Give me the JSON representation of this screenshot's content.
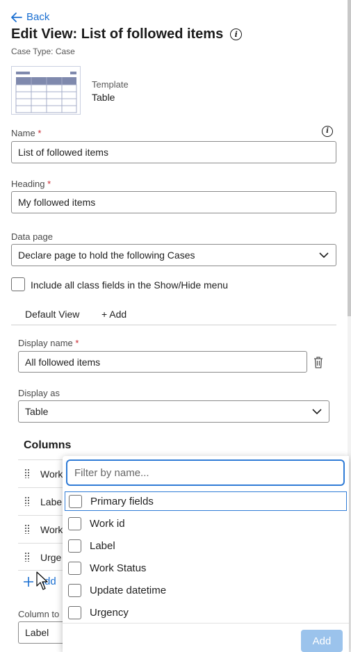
{
  "nav": {
    "back_label": "Back"
  },
  "header": {
    "title": "Edit View: List of followed items",
    "subtitle": "Case Type: Case"
  },
  "template": {
    "label": "Template",
    "value": "Table"
  },
  "form": {
    "name_label": "Name",
    "name_value": "List of followed items",
    "heading_label": "Heading",
    "heading_value": "My followed items",
    "datapage_label": "Data page",
    "datapage_value": "Declare page to hold the following Cases",
    "include_fields_label": "Include all class fields in the Show/Hide menu",
    "required_mark": "*"
  },
  "tabs": {
    "default_view": "Default View",
    "add": "+ Add"
  },
  "view": {
    "display_name_label": "Display name",
    "display_name_value": "All followed items",
    "display_as_label": "Display as",
    "display_as_value": "Table",
    "columns_title": "Columns",
    "column_rows": [
      "Work",
      "Labe",
      "Work",
      "Urge"
    ],
    "add_label": "Add",
    "column_to_label": "Column to",
    "column_to_value": "Label"
  },
  "popover": {
    "filter_placeholder": "Filter by name...",
    "options": [
      "Primary fields",
      "Work id",
      "Label",
      "Work Status",
      "Update datetime",
      "Urgency"
    ],
    "add_button": "Add"
  },
  "colors": {
    "accent": "#1a6fd1",
    "required": "#c8262e",
    "disabled_button": "#9bc3ec"
  },
  "icons": [
    "back-arrow-icon",
    "info-icon",
    "chevron-down-icon",
    "trash-icon",
    "drag-handle-icon",
    "plus-icon",
    "mouse-cursor-icon"
  ]
}
